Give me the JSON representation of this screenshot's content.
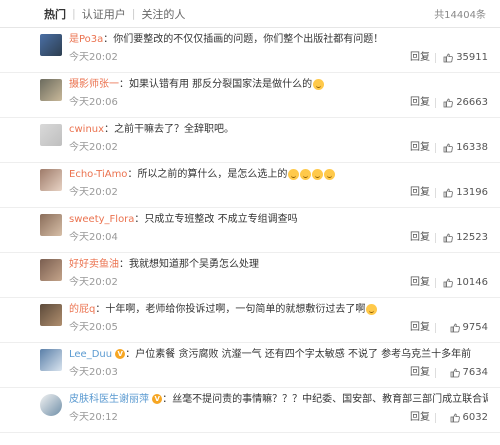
{
  "tabs": [
    "热门",
    "认证用户",
    "关注的人"
  ],
  "total": "共14404条",
  "reply_label": "回复",
  "comments": [
    {
      "user": "是Po3a",
      "text": "你们要整改的不仅仅插画的问题，你们整个出版社都有问题！",
      "time": "今天20:02",
      "likes": "35911",
      "emojis": 0,
      "avatar_colors": [
        "#4a6fa5",
        "#2d3e50"
      ]
    },
    {
      "user": "摄影师张一",
      "text": "如果认错有用 那反分裂国家法是做什么的",
      "time": "今天20:06",
      "likes": "26663",
      "emojis": 1,
      "avatar_colors": [
        "#6b6b5e",
        "#c9b99a"
      ]
    },
    {
      "user": "cwinux",
      "text": "之前干嘛去了？全辞职吧。",
      "time": "今天20:02",
      "likes": "16338",
      "emojis": 0,
      "avatar_colors": [
        "#d9d9d9",
        "#bfbfbf"
      ]
    },
    {
      "user": "Echo-TiAmo",
      "text": "所以之前的算什么，是怎么选上的",
      "time": "今天20:02",
      "likes": "13196",
      "emojis": 4,
      "avatar_colors": [
        "#9e7b6a",
        "#e8d3c4"
      ]
    },
    {
      "user": "sweety_Flora",
      "text": "只成立专班整改 不成立专组调查吗",
      "time": "今天20:04",
      "likes": "12523",
      "emojis": 0,
      "avatar_colors": [
        "#8a6d5a",
        "#d7bfa8"
      ]
    },
    {
      "user": "好好卖鱼油",
      "text": "我就想知道那个吴勇怎么处理",
      "time": "今天20:02",
      "likes": "10146",
      "emojis": 0,
      "avatar_colors": [
        "#7a5e50",
        "#c4a48a"
      ]
    },
    {
      "user": "的屁q",
      "text": "十年啊，老师给你投诉过啊，一句简单的就想敷衍过去了啊",
      "time": "今天20:05",
      "likes": "9754",
      "emojis": 1,
      "avatar_colors": [
        "#5c4a3a",
        "#b08f6f"
      ]
    },
    {
      "user": "Lee_Duu",
      "text": "户位素餐 贪污腐败 沆瀣一气 还有四个字太敏感 不说了 参考乌克兰十多年前",
      "time": "今天20:03",
      "likes": "7634",
      "emojis": 0,
      "badge": "V",
      "avatar_colors": [
        "#5a7fa8",
        "#d9e4ef"
      ]
    },
    {
      "user": "皮肤科医生谢丽萍",
      "text": "丝毫不提问责的事情嘛？？？中纪委、国安部、教育部三部门成立联合调查组吧！",
      "time": "今天20:12",
      "likes": "6032",
      "emojis": 0,
      "badge": "V",
      "round": true,
      "avatar_colors": [
        "#f2f2f2",
        "#6f8fa8"
      ]
    }
  ]
}
